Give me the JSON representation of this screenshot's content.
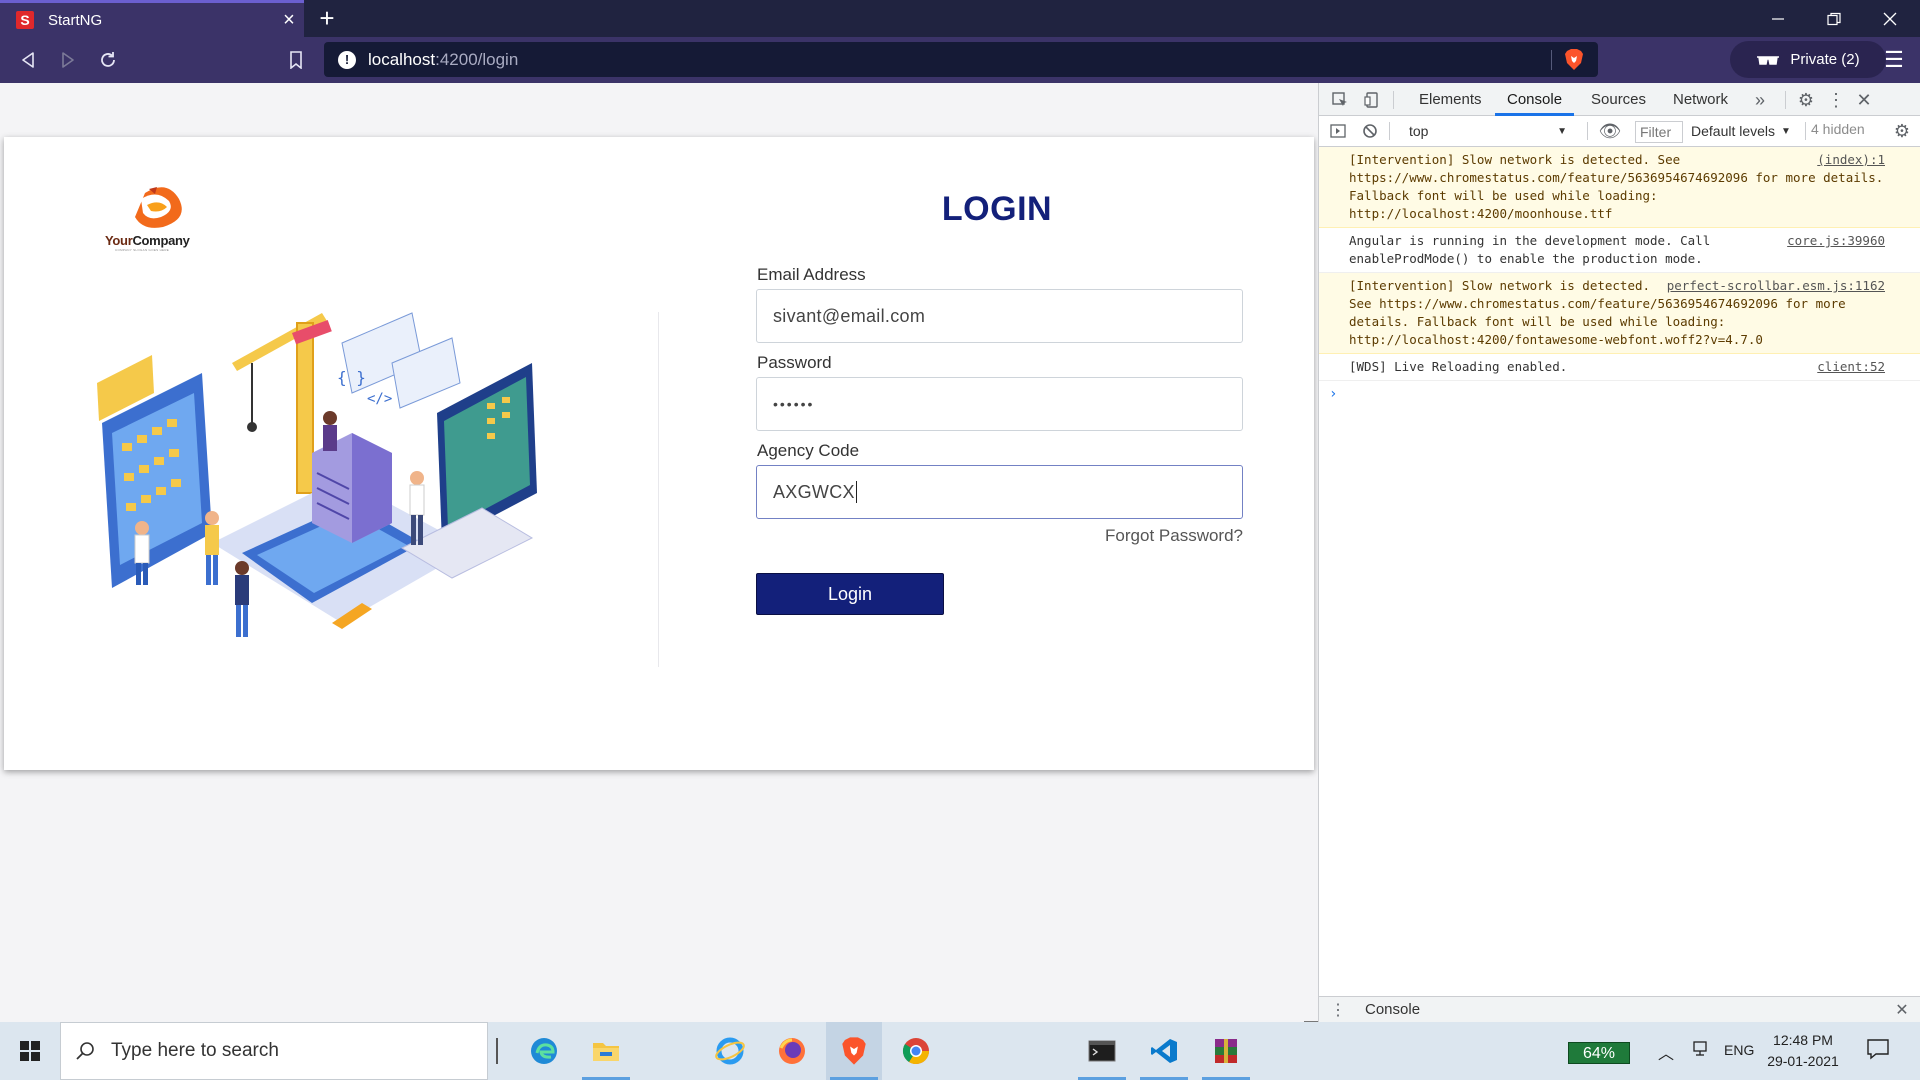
{
  "browser": {
    "tab_title": "StartNG",
    "favicon_letter": "S",
    "url_host": "localhost",
    "url_path": ":4200/login",
    "private_label": "Private (2)"
  },
  "login": {
    "logo_brand_1": "Your",
    "logo_brand_2": "Company",
    "logo_tagline": "COMPANY SLOGAN GOES HERE",
    "title": "LOGIN",
    "email_label": "Email Address",
    "email_value": "sivant@email.com",
    "password_label": "Password",
    "password_value": "••••••",
    "agency_label": "Agency Code",
    "agency_value": "AXGWCX",
    "forgot_label": "Forgot Password?",
    "button_label": "Login"
  },
  "devtools": {
    "tabs": [
      "Elements",
      "Console",
      "Sources",
      "Network"
    ],
    "active_tab": "Console",
    "context": "top",
    "filter_placeholder": "Filter",
    "levels_label": "Default levels",
    "hidden_count": "4 hidden",
    "messages": [
      {
        "text": "[Intervention] Slow network is detected. See https://www.chromestatus.com/feature/5636954674692096 for more details. Fallback font will be used while loading: http://localhost:4200/moonhouse.ttf",
        "source": "(index):1",
        "level": "warn"
      },
      {
        "text": "Angular is running in the development mode. Call enableProdMode() to enable the production mode.",
        "source": "core.js:39960",
        "level": "info"
      },
      {
        "text": "[Intervention] Slow network is detected. See https://www.chromestatus.com/feature/5636954674692096 for more details. Fallback font will be used while loading: http://localhost:4200/fontawesome-webfont.woff2?v=4.7.0",
        "source": "perfect-scrollbar.esm.js:1162",
        "level": "warn"
      },
      {
        "text": "[WDS] Live Reloading enabled.",
        "source": "client:52",
        "level": "info"
      }
    ],
    "drawer_label": "Console"
  },
  "taskbar": {
    "search_placeholder": "Type here to search",
    "battery": "64%",
    "language": "ENG",
    "time": "12:48 PM",
    "date": "29-01-2021"
  },
  "colors": {
    "brand_navy": "#13207a",
    "browser_dark": "#202340",
    "browser_toolbar": "#3b3368",
    "devtools_accent": "#1a73e8"
  }
}
